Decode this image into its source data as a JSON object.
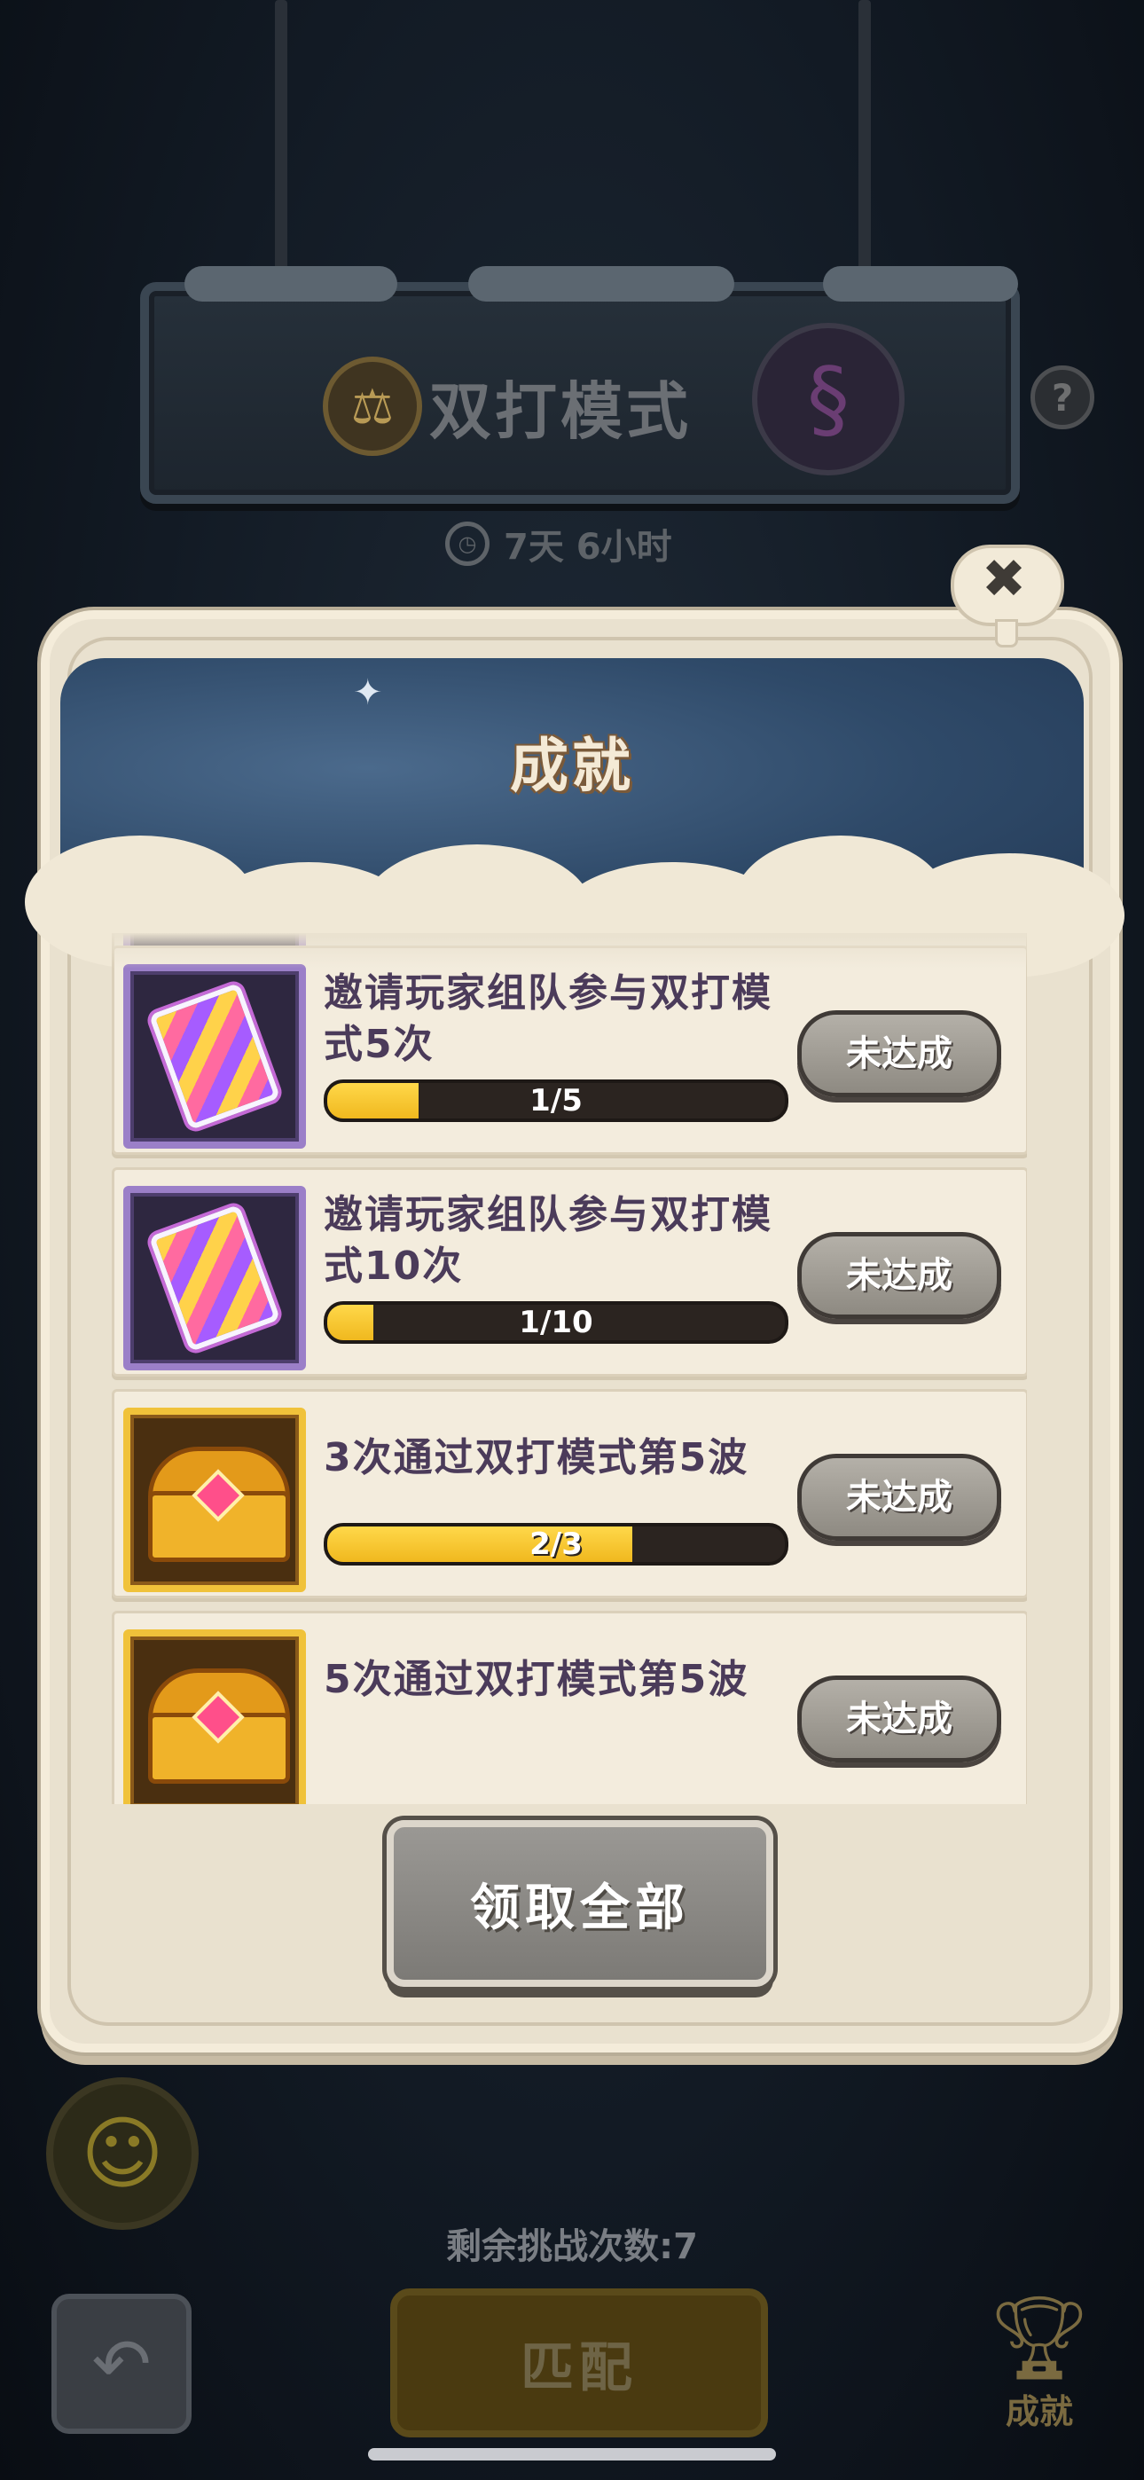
{
  "header": {
    "mode_title": "双打模式",
    "timer_text": "7天 6小时",
    "help_label": "?"
  },
  "modal": {
    "title": "成就",
    "close_label": "✖",
    "claim_all_label": "领取全部"
  },
  "achievements": [
    {
      "title": "邀请玩家组队参与双打模式5次",
      "progress_text": "1/5",
      "progress": 0.2,
      "status": "未达成",
      "icon": "ticket-icon"
    },
    {
      "title": "邀请玩家组队参与双打模式10次",
      "progress_text": "1/10",
      "progress": 0.1,
      "status": "未达成",
      "icon": "ticket-icon"
    },
    {
      "title": "3次通过双打模式第5波",
      "progress_text": "2/3",
      "progress": 0.667,
      "status": "未达成",
      "icon": "chest-icon"
    },
    {
      "title": "5次通过双打模式第5波",
      "status": "未达成",
      "icon": "chest-icon"
    }
  ],
  "footer": {
    "remaining_text": "剩余挑战次数:7",
    "match_label": "匹配",
    "trophy_label": "成就"
  },
  "colors": {
    "progress_fill": "#f0b81e",
    "modal_bg": "#e9e1cf",
    "header_sky": "#2f4a69"
  }
}
